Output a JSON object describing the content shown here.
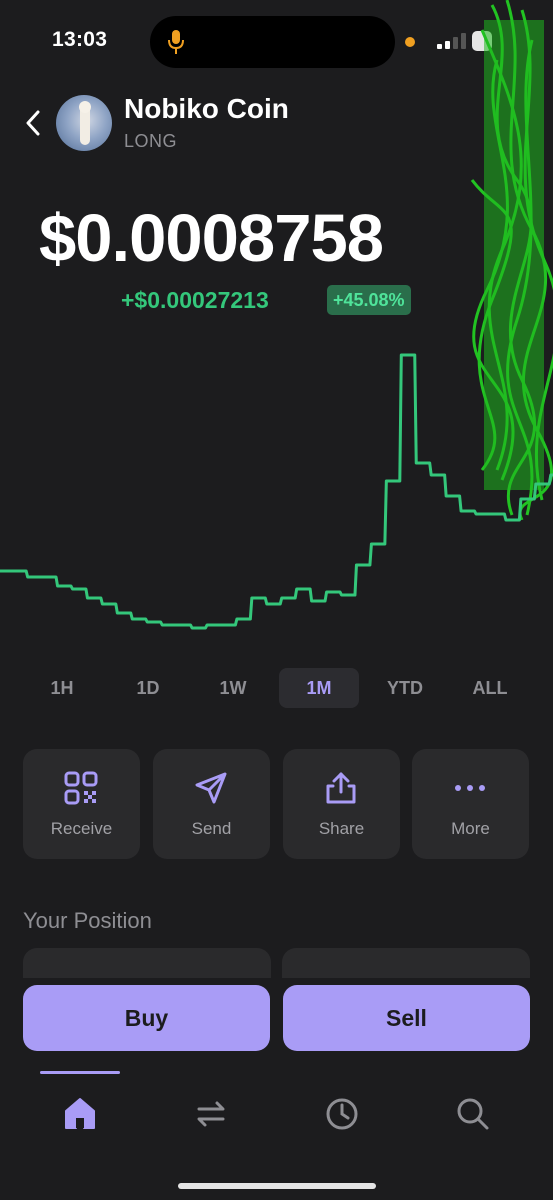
{
  "status": {
    "time": "13:03"
  },
  "header": {
    "coin_name": "Nobiko Coin",
    "ticker": "LONG"
  },
  "price": {
    "value": "$0.0008758",
    "change": "+$0.00027213",
    "change_pct": "+45.08%"
  },
  "colors": {
    "accent": "#a99cf6",
    "positive": "#34c77b",
    "background": "#1c1c1e",
    "card": "#2a2a2c"
  },
  "chart_data": {
    "type": "line",
    "series": [
      {
        "values": [
          0.000595,
          0.000595,
          0.000585,
          0.000585,
          0.00057,
          0.000565,
          0.00055,
          0.00054,
          0.000525,
          0.000515,
          0.00051,
          0.000505,
          0.000505,
          0.0005,
          0.000505,
          0.000505,
          0.000515,
          0.00055,
          0.00054,
          0.00055,
          0.000565,
          0.000545,
          0.00056,
          0.000555,
          0.000605,
          0.00064,
          0.000745,
          0.000955,
          0.000775,
          0.000755,
          0.00072,
          0.000695,
          0.00069,
          0.00069,
          0.00068,
          0.000715,
          0.00074,
          0.000755
        ]
      }
    ]
  },
  "ranges": [
    "1H",
    "1D",
    "1W",
    "1M",
    "YTD",
    "ALL"
  ],
  "active_range": "1M",
  "actions": [
    {
      "label": "Receive",
      "icon": "qr-code-icon"
    },
    {
      "label": "Send",
      "icon": "send-icon"
    },
    {
      "label": "Share",
      "icon": "share-icon"
    },
    {
      "label": "More",
      "icon": "more-icon"
    }
  ],
  "position": {
    "title": "Your Position"
  },
  "trade": {
    "buy": "Buy",
    "sell": "Sell"
  },
  "tabs": [
    {
      "icon": "home-icon"
    },
    {
      "icon": "swap-icon"
    },
    {
      "icon": "history-icon"
    },
    {
      "icon": "search-icon"
    }
  ]
}
